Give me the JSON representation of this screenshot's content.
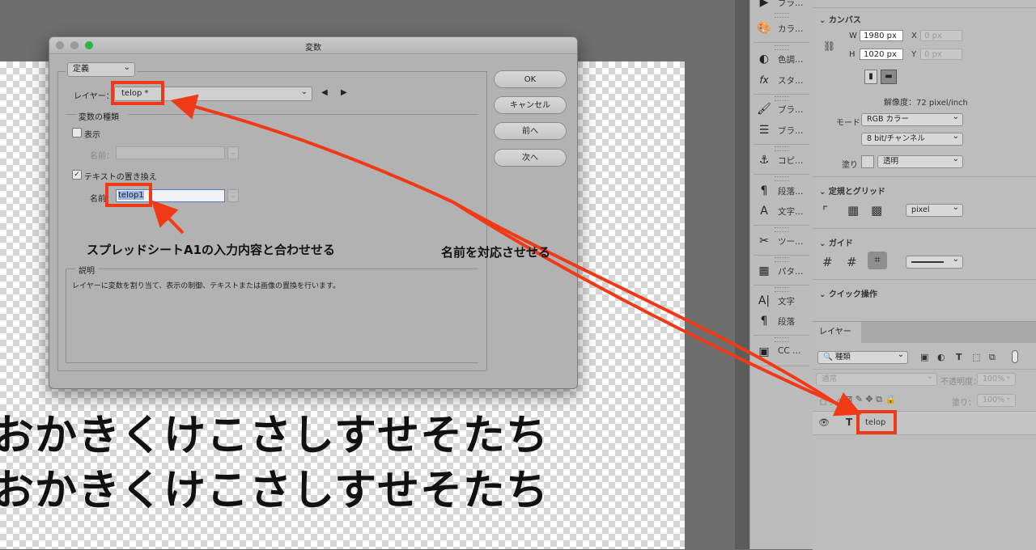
{
  "canvas": {
    "line1": "おかきくけこさしすせそたち",
    "line2": "おかきくけこさしすせそたち"
  },
  "toolstrip": {
    "items": [
      {
        "label": "ブラ…",
        "icon": "play-icon"
      },
      {
        "label": "カラ…",
        "icon": "palette-icon"
      },
      {
        "label": "色調…",
        "icon": "adjust-icon"
      },
      {
        "label": "スタ…",
        "icon": "fx-icon"
      },
      {
        "label": "ブラ…",
        "icon": "brush-icon"
      },
      {
        "label": "ブラ…",
        "icon": "brush-settings-icon"
      },
      {
        "label": "コピ…",
        "icon": "clone-icon"
      },
      {
        "label": "段落…",
        "icon": "paragraph-style-icon"
      },
      {
        "label": "文字…",
        "icon": "character-style-icon"
      },
      {
        "label": "ツー…",
        "icon": "tool-presets-icon"
      },
      {
        "label": "パタ…",
        "icon": "pattern-icon"
      },
      {
        "label": "文字",
        "icon": "character-icon"
      },
      {
        "label": "段落",
        "icon": "paragraph-icon"
      },
      {
        "label": "CC …",
        "icon": "cc-libraries-icon"
      }
    ]
  },
  "properties": {
    "canvas_header": "カンバス",
    "w_label": "W",
    "w_value": "1980 px",
    "h_label": "H",
    "h_value": "1020 px",
    "x_label": "X",
    "x_placeholder": "0 px",
    "y_label": "Y",
    "y_placeholder": "0 px",
    "resolution": "解像度：72 pixel/inch",
    "mode_label": "モード",
    "mode_value": "RGB カラー",
    "depth_value": "8 bit/チャンネル",
    "fill_label": "塗り",
    "fill_value": "透明",
    "rulers_header": "定規とグリッド",
    "units_value": "pixel",
    "guides_header": "ガイド",
    "quick_header": "クイック操作"
  },
  "layers": {
    "tab": "レイヤー",
    "filter_value": "種類",
    "blend_value": "通常",
    "opacity_label": "不透明度：",
    "opacity_value": "100%",
    "lock_label": "ロック：",
    "fill_label": "塗り：",
    "fill_value": "100%",
    "rows": [
      {
        "type_icon": "T",
        "name": "telop"
      }
    ]
  },
  "dialog": {
    "title": "変数",
    "mode_select": "定義",
    "layer_label": "レイヤー：",
    "layer_value": "telop *",
    "var_types_title": "変数の種類",
    "visibility_label": "表示",
    "visibility_checked": false,
    "visibility_name_label": "名前：",
    "text_replace_label": "テキストの置き換え",
    "text_replace_checked": true,
    "text_name_label": "名前：",
    "text_name_value": "telop1",
    "desc_title": "説明",
    "desc_text": "レイヤーに変数を割り当て、表示の制御、テキストまたは画像の置換を行います。",
    "buttons": {
      "ok": "OK",
      "cancel": "キャンセル",
      "prev": "前へ",
      "next": "次へ"
    }
  },
  "annotations": {
    "note_left": "スプレッドシートA1の入力内容と合わせせる",
    "note_right": "名前を対応させせる",
    "highlight_color": "#f03a17"
  }
}
